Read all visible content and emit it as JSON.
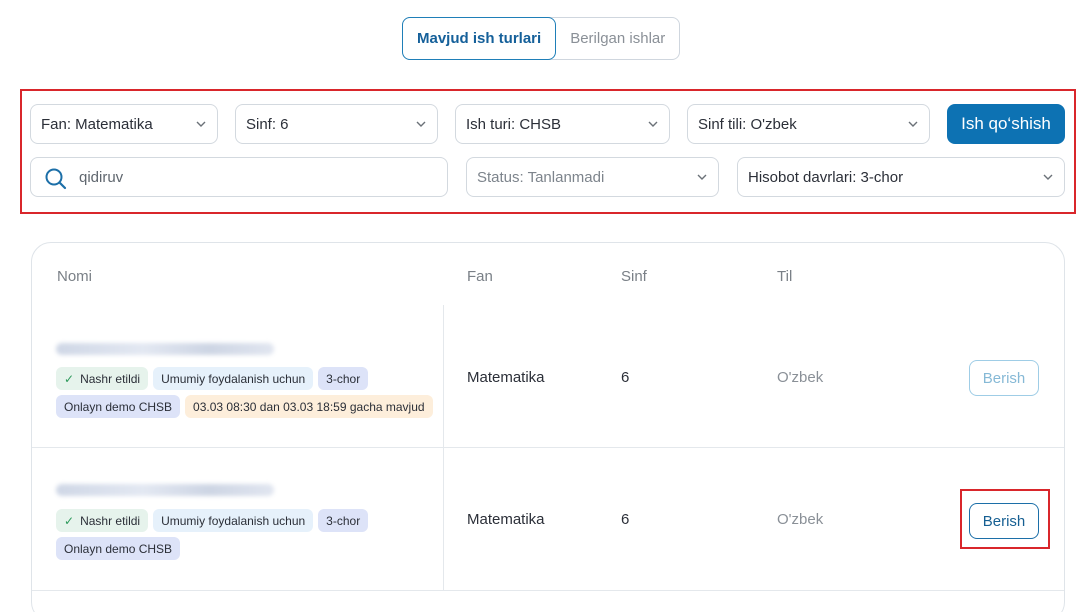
{
  "tabs": [
    {
      "label": "Mavjud ish turlari",
      "active": true
    },
    {
      "label": "Berilgan ishlar",
      "active": false
    }
  ],
  "filters": {
    "fan": "Fan: Matematika",
    "sinf": "Sinf: 6",
    "ish_turi": "Ish turi: CHSB",
    "sinf_tili": "Sinf tili: O'zbek",
    "add_button": "Ish qo‘shish",
    "search_placeholder": "qidiruv",
    "status": "Status: Tanlanmadi",
    "hisobot": "Hisobot davrlari: 3-chor"
  },
  "table": {
    "headers": {
      "name": "Nomi",
      "fan": "Fan",
      "sinf": "Sinf",
      "til": "Til"
    },
    "rows": [
      {
        "tags": {
          "published": "Nashr etildi",
          "usage": "Umumiy foydalanish uchun",
          "quarter": "3-chor",
          "demo": "Onlayn demo CHSB",
          "availability": "03.03 08:30 dan 03.03 18:59 gacha mavjud"
        },
        "fan": "Matematika",
        "sinf": "6",
        "til": "O'zbek",
        "button": "Berish"
      },
      {
        "tags": {
          "published": "Nashr etildi",
          "usage": "Umumiy foydalanish uchun",
          "quarter": "3-chor",
          "demo": "Onlayn demo CHSB"
        },
        "fan": "Matematika",
        "sinf": "6",
        "til": "O'zbek",
        "button": "Berish"
      }
    ]
  },
  "colors": {
    "accent": "#0d72b3",
    "highlight": "#d9262b"
  }
}
